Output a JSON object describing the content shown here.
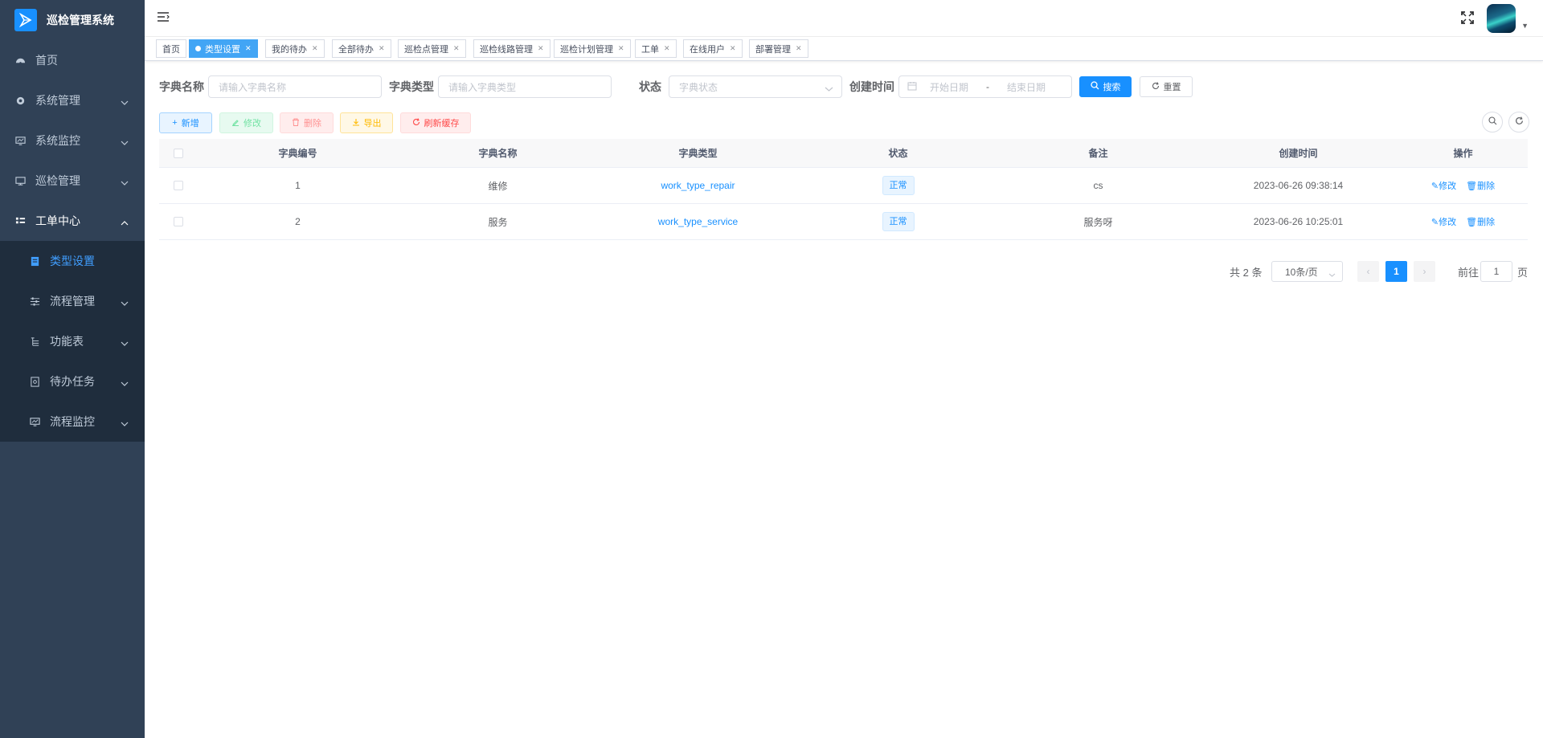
{
  "app": {
    "title": "巡检管理系统"
  },
  "sidebar": {
    "items": [
      {
        "label": "首页"
      },
      {
        "label": "系统管理"
      },
      {
        "label": "系统监控"
      },
      {
        "label": "巡检管理"
      },
      {
        "label": "工单中心"
      }
    ],
    "submenu": [
      {
        "label": "类型设置"
      },
      {
        "label": "流程管理"
      },
      {
        "label": "功能表"
      },
      {
        "label": "待办任务"
      },
      {
        "label": "流程监控"
      }
    ]
  },
  "tags": [
    {
      "label": "首页"
    },
    {
      "label": "类型设置"
    },
    {
      "label": "我的待办"
    },
    {
      "label": "全部待办"
    },
    {
      "label": "巡检点管理"
    },
    {
      "label": "巡检线路管理"
    },
    {
      "label": "巡检计划管理"
    },
    {
      "label": "工单"
    },
    {
      "label": "在线用户"
    },
    {
      "label": "部署管理"
    }
  ],
  "search": {
    "dict_name_label": "字典名称",
    "dict_name_placeholder": "请输入字典名称",
    "dict_type_label": "字典类型",
    "dict_type_placeholder": "请输入字典类型",
    "status_label": "状态",
    "status_placeholder": "字典状态",
    "created_label": "创建时间",
    "start_placeholder": "开始日期",
    "range_sep": "-",
    "end_placeholder": "结束日期",
    "search_button": "搜索",
    "reset_button": "重置"
  },
  "toolbar": {
    "add": "新增",
    "edit": "修改",
    "delete": "删除",
    "export": "导出",
    "refresh_cache": "刷新缓存"
  },
  "table": {
    "headers": [
      "字典编号",
      "字典名称",
      "字典类型",
      "状态",
      "备注",
      "创建时间",
      "操作"
    ],
    "rows": [
      {
        "id": "1",
        "name": "维修",
        "type": "work_type_repair",
        "status": "正常",
        "remark": "cs",
        "created": "2023-06-26 09:38:14"
      },
      {
        "id": "2",
        "name": "服务",
        "type": "work_type_service",
        "status": "正常",
        "remark": "服务呀",
        "created": "2023-06-26 10:25:01"
      }
    ],
    "op_edit": "修改",
    "op_delete": "删除"
  },
  "pagination": {
    "total": "共 2 条",
    "page_size": "10条/页",
    "current_page": "1",
    "goto_label": "前往",
    "goto_value": "1",
    "page_suffix": "页"
  },
  "colors": {
    "sidebar_bg": "#304156",
    "primary": "#1890ff"
  }
}
